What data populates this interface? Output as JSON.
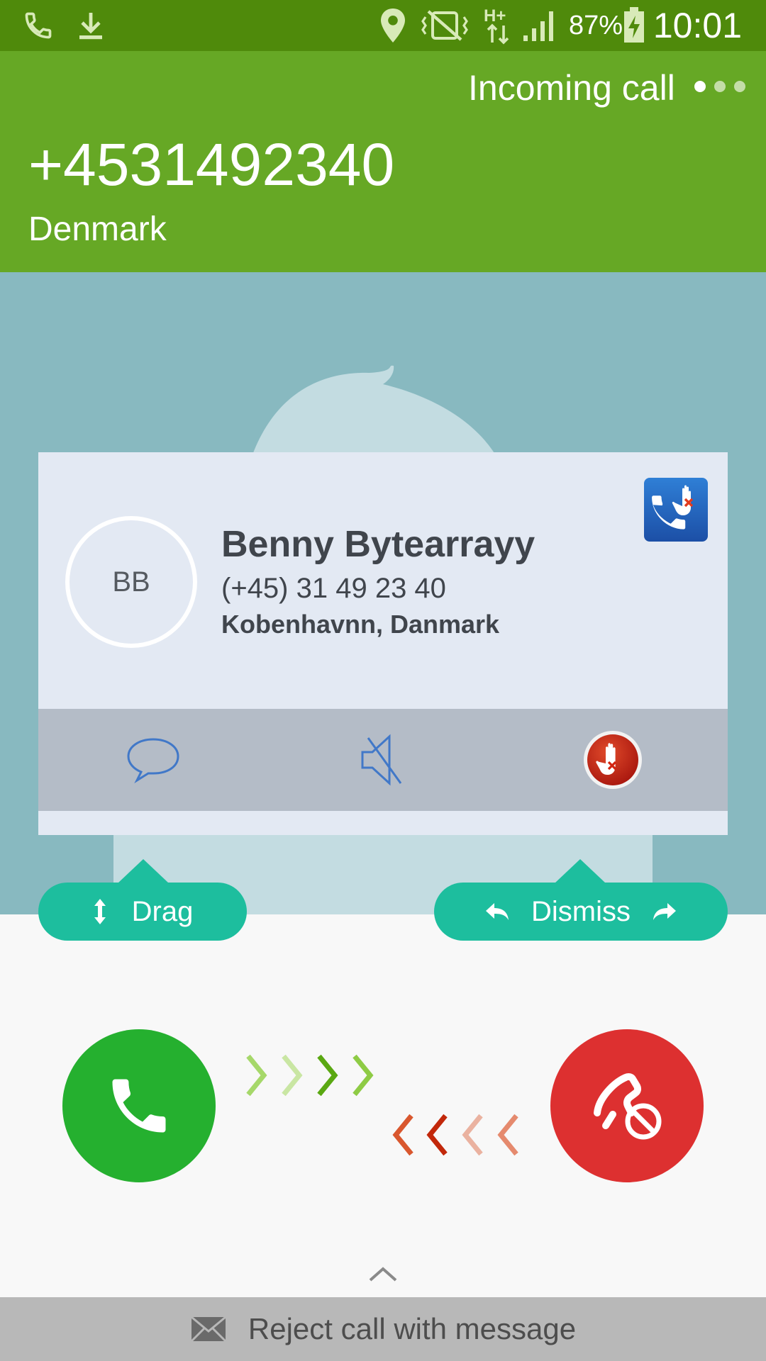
{
  "status_bar": {
    "battery": "87%",
    "time": "10:01",
    "icons": [
      "phone-icon",
      "download-icon",
      "location-icon",
      "vibrate-off-icon",
      "hplus-data-icon",
      "signal-icon",
      "battery-charging-icon"
    ]
  },
  "call": {
    "status": "Incoming call",
    "number": "+4531492340",
    "country": "Denmark"
  },
  "contact": {
    "initials": "BB",
    "name": "Benny Bytearrayy",
    "phone": "(+45) 31 49 23 40",
    "location": "Kobenhavnn, Danmark"
  },
  "card_actions": [
    "message-icon",
    "mute-icon",
    "block-icon"
  ],
  "controls": {
    "drag_label": "Drag",
    "dismiss_label": "Dismiss"
  },
  "reject_message": {
    "label": "Reject call with message"
  },
  "colors": {
    "status_bar": "#4f8a0b",
    "header": "#66a825",
    "photo_bg": "#88b9c0",
    "card": "#e3e9f3",
    "card_actions": "#b4bcc7",
    "pill": "#1dbe9e",
    "accept": "#25b02f",
    "decline": "#dd3030",
    "reject_bar": "#b8b8b8"
  }
}
